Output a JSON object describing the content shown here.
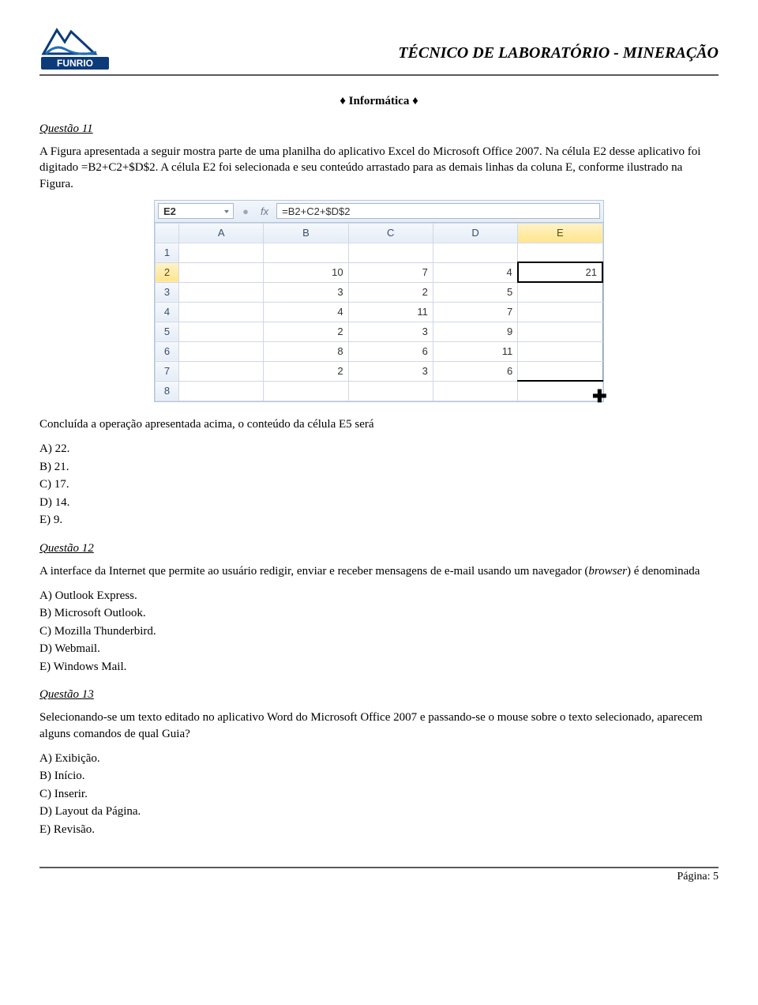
{
  "header": {
    "logo_text": "FUNRIO",
    "title": "TÉCNICO DE LABORATÓRIO - MINERAÇÃO"
  },
  "section": "♦ Informática ♦",
  "q11": {
    "label": "Questão 11",
    "text": "A Figura apresentada a seguir mostra parte de uma planilha do aplicativo Excel do Microsoft Office 2007. Na célula E2 desse aplicativo foi digitado  =B2+C2+$D$2. A célula E2 foi selecionada e seu conteúdo arrastado para as demais linhas da coluna E, conforme ilustrado na Figura."
  },
  "excel": {
    "namebox": "E2",
    "fx": "fx",
    "formula": "=B2+C2+$D$2",
    "cols": [
      "A",
      "B",
      "C",
      "D",
      "E"
    ],
    "rows": [
      {
        "n": "1",
        "A": "",
        "B": "",
        "C": "",
        "D": "",
        "E": ""
      },
      {
        "n": "2",
        "A": "",
        "B": "10",
        "C": "7",
        "D": "4",
        "E": "21"
      },
      {
        "n": "3",
        "A": "",
        "B": "3",
        "C": "2",
        "D": "5",
        "E": ""
      },
      {
        "n": "4",
        "A": "",
        "B": "4",
        "C": "11",
        "D": "7",
        "E": ""
      },
      {
        "n": "5",
        "A": "",
        "B": "2",
        "C": "3",
        "D": "9",
        "E": ""
      },
      {
        "n": "6",
        "A": "",
        "B": "8",
        "C": "6",
        "D": "11",
        "E": ""
      },
      {
        "n": "7",
        "A": "",
        "B": "2",
        "C": "3",
        "D": "6",
        "E": ""
      },
      {
        "n": "8",
        "A": "",
        "B": "",
        "C": "",
        "D": "",
        "E": ""
      }
    ]
  },
  "q11_post": "Concluída a operação apresentada acima, o conteúdo da célula E5 será",
  "q11_opts": {
    "A": "A)  22.",
    "B": "B)  21.",
    "C": "C)  17.",
    "D": "D)  14.",
    "E": "E)  9."
  },
  "q12": {
    "label": "Questão 12",
    "text": "A interface da Internet que permite ao usuário redigir, enviar e receber mensagens de e-mail usando um navegador (browser) é denominada",
    "opts": {
      "A": "A)  Outlook Express.",
      "B": "B)  Microsoft Outlook.",
      "C": "C)  Mozilla Thunderbird.",
      "D": "D)  Webmail.",
      "E": "E)  Windows Mail."
    }
  },
  "q13": {
    "label": "Questão 13",
    "text": "Selecionando-se um texto editado no aplicativo Word do Microsoft Office 2007 e passando-se o mouse sobre o texto selecionado, aparecem alguns comandos de qual Guia?",
    "opts": {
      "A": "A)  Exibição.",
      "B": "B)  Início.",
      "C": "C)  Inserir.",
      "D": "D)  Layout da Página.",
      "E": "E)  Revisão."
    }
  },
  "footer": "Página: 5"
}
